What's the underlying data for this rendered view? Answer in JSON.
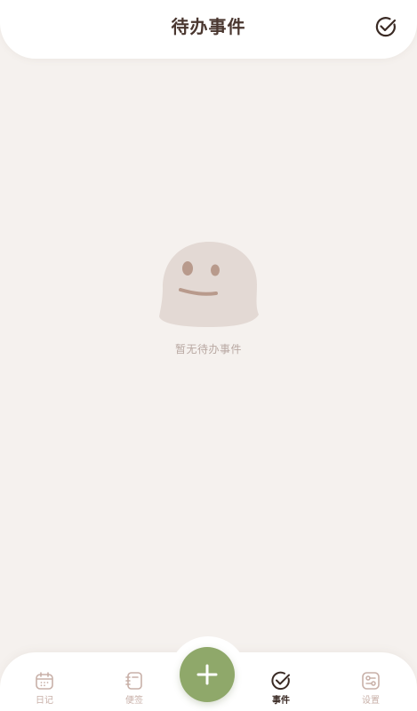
{
  "header": {
    "title": "待办事件",
    "action_icon": "check-circle-icon"
  },
  "empty_state": {
    "icon": "ghost-face-icon",
    "text": "暂无待办事件"
  },
  "tabbar": {
    "items": [
      {
        "label": "日记",
        "icon": "calendar-icon",
        "active": false
      },
      {
        "label": "便签",
        "icon": "notebook-icon",
        "active": false
      },
      {
        "label": "事件",
        "icon": "check-circle-icon",
        "active": true
      },
      {
        "label": "设置",
        "icon": "settings-toggle-icon",
        "active": false
      }
    ],
    "add_button_icon": "plus-icon"
  },
  "colors": {
    "background": "#f5f1ee",
    "title": "#4a3730",
    "accent_green": "#8fa86a",
    "inactive": "#c8b0a8",
    "ghost": "#e3d9d4"
  }
}
